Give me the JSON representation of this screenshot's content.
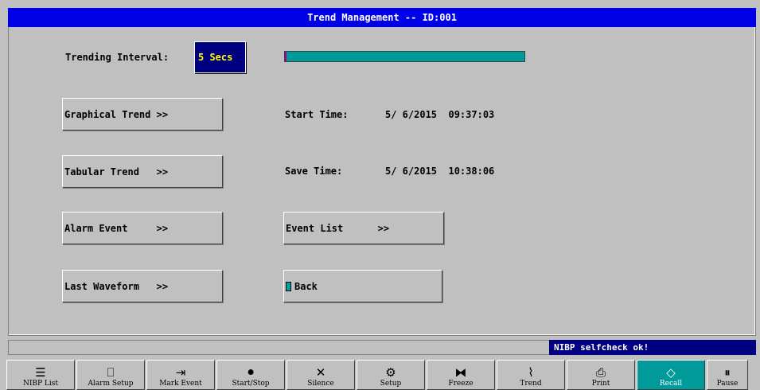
{
  "title": "Trend Management -- ID:001",
  "interval": {
    "label": "Trending Interval:",
    "value": "5 Secs"
  },
  "progress": {
    "fill_fraction": 1.0,
    "color": "#009a9a"
  },
  "buttons": {
    "graphical_trend": "Graphical Trend >>",
    "tabular_trend": "Tabular Trend   >>",
    "alarm_event": "Alarm Event     >>",
    "last_waveform": "Last Waveform   >>",
    "event_list": "Event List      >>",
    "back": "Back"
  },
  "times": {
    "start_label": "Start Time:",
    "start_value": "5/ 6/2015  09:37:03",
    "save_label": "Save Time:",
    "save_value": "5/ 6/2015  10:38:06"
  },
  "status": {
    "message": "NIBP selfcheck ok!"
  },
  "toolbar": [
    {
      "label": "NIBP List",
      "icon": "list-icon",
      "glyph": "☰"
    },
    {
      "label": "Alarm Setup",
      "icon": "book-icon",
      "glyph": "⎕"
    },
    {
      "label": "Mark Event",
      "icon": "mark-icon",
      "glyph": "⇥"
    },
    {
      "label": "Start/Stop",
      "icon": "cuff-icon",
      "glyph": "⚫"
    },
    {
      "label": "Silence",
      "icon": "silence-icon",
      "glyph": "✕"
    },
    {
      "label": "Setup",
      "icon": "setup-icon",
      "glyph": "⚙"
    },
    {
      "label": "Freeze",
      "icon": "freeze-icon",
      "glyph": "⧓"
    },
    {
      "label": "Trend",
      "icon": "trend-icon",
      "glyph": "⌇"
    },
    {
      "label": "Print",
      "icon": "print-icon",
      "glyph": "⎙"
    },
    {
      "label": "Recall",
      "icon": "recall-icon",
      "glyph": "◇"
    },
    {
      "label": "Pause",
      "icon": "pause-icon",
      "glyph": "⏸"
    }
  ],
  "colors": {
    "title_bg": "#0000e6",
    "interval_bg": "#000080",
    "interval_text": "#ffff00",
    "active_tool": "#009a9a",
    "status_bg": "#000080"
  }
}
